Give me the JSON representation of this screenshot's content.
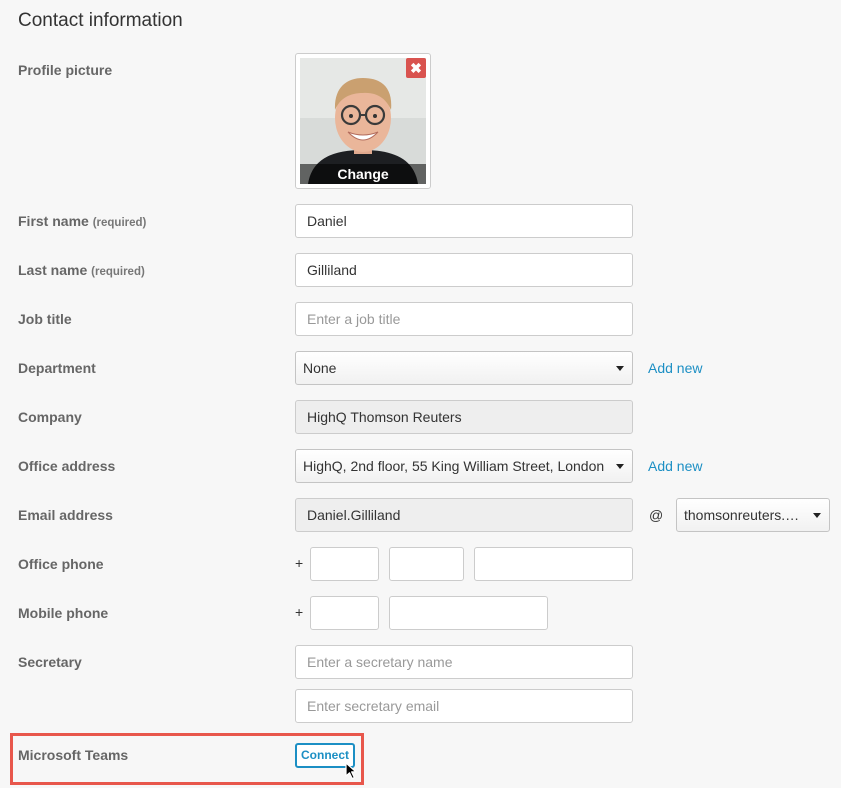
{
  "section_title": "Contact information",
  "required_suffix": "(required)",
  "profile_picture": {
    "label": "Profile picture",
    "change_label": "Change",
    "remove_icon": "close-icon"
  },
  "first_name": {
    "label": "First name",
    "value": "Daniel"
  },
  "last_name": {
    "label": "Last name",
    "value": "Gilliland"
  },
  "job_title": {
    "label": "Job title",
    "placeholder": "Enter a job title"
  },
  "department": {
    "label": "Department",
    "value": "None",
    "add_new": "Add new"
  },
  "company": {
    "label": "Company",
    "value": "HighQ Thomson Reuters"
  },
  "office_address": {
    "label": "Office address",
    "value": "HighQ, 2nd floor, 55 King William Street, London",
    "add_new": "Add new"
  },
  "email": {
    "label": "Email address",
    "value": "Daniel.Gilliland",
    "at": "@",
    "domain": "thomsonreuters.com"
  },
  "office_phone": {
    "label": "Office phone",
    "plus": "+"
  },
  "mobile_phone": {
    "label": "Mobile phone",
    "plus": "+"
  },
  "secretary": {
    "label": "Secretary",
    "name_placeholder": "Enter a secretary name",
    "email_placeholder": "Enter secretary email"
  },
  "microsoft_teams": {
    "label": "Microsoft Teams",
    "connect_label": "Connect"
  },
  "colors": {
    "link": "#1c8fc4",
    "highlight": "#e8574c",
    "remove": "#d9534f"
  }
}
